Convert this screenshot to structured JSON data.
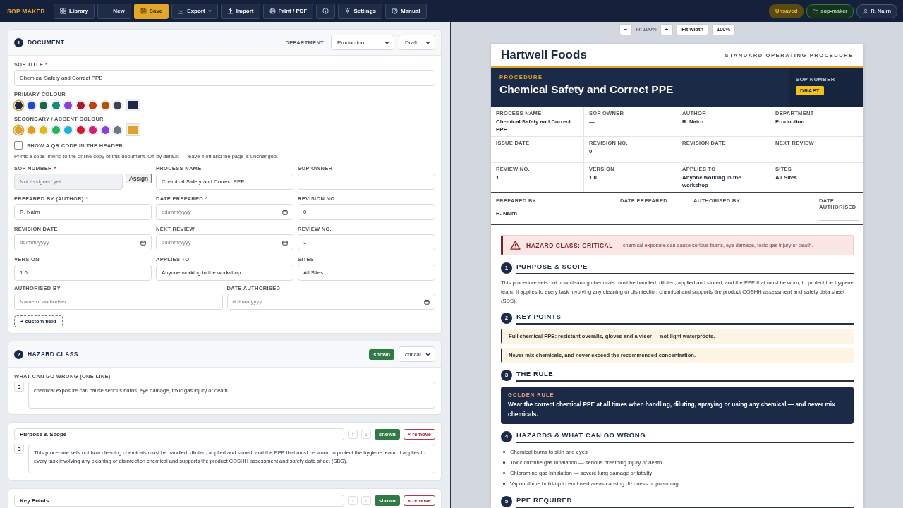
{
  "app": {
    "name": "SOP MAKER"
  },
  "toolbar": [
    {
      "label": "Library",
      "kind": "normal"
    },
    {
      "label": "New",
      "kind": "normal"
    },
    {
      "label": "Save",
      "kind": "primary"
    },
    {
      "label": "Export",
      "kind": "dropdown"
    },
    {
      "label": "Import",
      "kind": "normal"
    },
    {
      "label": "Print / PDF",
      "kind": "normal"
    },
    {
      "kind": "normal"
    },
    {
      "label": "Settings",
      "kind": "normal"
    },
    {
      "label": "Manual",
      "kind": "normal"
    }
  ],
  "status": [
    {
      "label": "Unsaved",
      "kind": "warning"
    },
    {
      "label": "sop-maker",
      "kind": "folder"
    },
    {
      "label": "R. Nairn",
      "kind": "user"
    }
  ],
  "zoom_bar": [
    {
      "label": "−",
      "kind": "button"
    },
    {
      "label": "Fit 100%",
      "kind": "text"
    },
    {
      "label": "+",
      "kind": "button"
    },
    {
      "label": "Fit width",
      "kind": "button"
    },
    {
      "label": "100%",
      "kind": "button"
    }
  ],
  "document_card": {
    "number": "1",
    "title": "DOCUMENT",
    "department_label": "DEPARTMENT",
    "department": "Production",
    "status": "Draft",
    "sop_title": {
      "label": "SOP TITLE",
      "required_mark": "*",
      "value": "Chemical Safety and Correct PPE"
    },
    "palettes": [
      {
        "label": "PRIMARY COLOUR",
        "swatches": [
          {
            "color": "#1b2a47",
            "selected": true
          },
          {
            "color": "#2346d4",
            "selected": false
          },
          {
            "color": "#176a45",
            "selected": false
          },
          {
            "color": "#1b8a72",
            "selected": false
          },
          {
            "color": "#8b3fe0",
            "selected": false
          },
          {
            "color": "#b0192a",
            "selected": false
          },
          {
            "color": "#c2410c",
            "selected": false
          },
          {
            "color": "#b45309",
            "selected": false
          },
          {
            "color": "#3b4252",
            "selected": false
          }
        ]
      },
      {
        "label": "SECONDARY / ACCENT COLOUR",
        "swatches": [
          {
            "color": "#e0a22a",
            "selected": true
          },
          {
            "color": "#ea9a14",
            "selected": false
          },
          {
            "color": "#e2b812",
            "selected": false
          },
          {
            "color": "#22b455",
            "selected": false
          },
          {
            "color": "#1fb0e0",
            "selected": false
          },
          {
            "color": "#d0192f",
            "selected": false
          },
          {
            "color": "#d81b7a",
            "selected": false
          },
          {
            "color": "#8b3fe0",
            "selected": false
          },
          {
            "color": "#6b7789",
            "selected": false
          }
        ]
      }
    ],
    "qr": {
      "label": "SHOW A QR CODE IN THE HEADER",
      "checked": false,
      "help": "Prints a code linking to the online copy of this document. Off by default — leave it off and the page is unchanged."
    },
    "field_rows": [
      [
        {
          "label": "SOP NUMBER",
          "required_mark": "*",
          "kind": "locked",
          "placeholder": "Not assigned yet",
          "button": "Assign"
        },
        {
          "label": "PROCESS NAME",
          "kind": "text",
          "value": "Chemical Safety and Correct PPE"
        },
        {
          "label": "SOP OWNER",
          "kind": "text"
        }
      ],
      [
        {
          "label": "PREPARED BY (AUTHOR)",
          "required_mark": "*",
          "kind": "text",
          "value": "R. Nairn"
        },
        {
          "label": "DATE PREPARED",
          "required_mark": "*",
          "kind": "date",
          "placeholder": "dd/mm/yyyy"
        },
        {
          "label": "REVISION NO.",
          "kind": "text",
          "value": "0"
        }
      ],
      [
        {
          "label": "REVISION DATE",
          "kind": "date",
          "placeholder": "dd/mm/yyyy"
        },
        {
          "label": "NEXT REVIEW",
          "kind": "date",
          "placeholder": "dd/mm/yyyy"
        },
        {
          "label": "REVIEW NO.",
          "kind": "text",
          "value": "1"
        }
      ],
      [
        {
          "label": "VERSION",
          "kind": "text",
          "value": "1.0"
        },
        {
          "label": "APPLIES TO",
          "kind": "text",
          "value": "Anyone working in the workshop"
        },
        {
          "label": "SITES",
          "kind": "text",
          "value": "All Sites"
        }
      ],
      [
        {
          "label": "AUTHORISED BY",
          "kind": "text",
          "placeholder": "Name of authoriser"
        },
        {
          "label": "DATE AUTHORISED",
          "kind": "date",
          "placeholder": "dd/mm/yyyy"
        }
      ]
    ],
    "custom_field_button": "+ custom field"
  },
  "hazard_card": {
    "number": "2",
    "title": "HAZARD CLASS",
    "visibility_label": "shown",
    "visible": true,
    "level": "critical",
    "field_label": "WHAT CAN GO WRONG (ONE LINE)",
    "bold_button": "B",
    "text": "chemical exposure can cause serious burns, eye damage, toxic gas injury or death."
  },
  "section_cards": [
    {
      "title": "Purpose & Scope",
      "up": "↑",
      "down": "↓",
      "visibility_label": "shown",
      "visible": true,
      "remove": "× remove",
      "bold_button": "B",
      "body": "This procedure sets out how cleaning chemicals must be handled, diluted, applied and stored, and the PPE that must be worn, to protect the hygiene team. It applies to every task involving any cleaning or disinfection chemical and supports the product COSHH assessment and safety data sheet (SDS)."
    },
    {
      "title": "Key Points",
      "up": "↑",
      "down": "↓",
      "visibility_label": "shown",
      "visible": true,
      "remove": "× remove"
    }
  ],
  "document": {
    "company": "Hartwell Foods",
    "doc_type": "STANDARD OPERATING PROCEDURE",
    "kicker": "PROCEDURE",
    "title": "Chemical Safety and Correct PPE",
    "sop_number_label": "SOP NUMBER",
    "status_badge": "DRAFT",
    "meta": [
      {
        "label": "PROCESS NAME",
        "value": "Chemical Safety and Correct PPE"
      },
      {
        "label": "SOP OWNER",
        "value": "—"
      },
      {
        "label": "AUTHOR",
        "value": "R. Nairn"
      },
      {
        "label": "DEPARTMENT",
        "value": "Production"
      },
      {
        "label": "ISSUE DATE",
        "value": "—"
      },
      {
        "label": "REVISION NO.",
        "value": "0"
      },
      {
        "label": "REVISION DATE",
        "value": "—"
      },
      {
        "label": "NEXT REVIEW",
        "value": "—"
      },
      {
        "label": "REVIEW NO.",
        "value": "1"
      },
      {
        "label": "VERSION",
        "value": "1.0"
      },
      {
        "label": "APPLIES TO",
        "value": "Anyone working in the workshop"
      },
      {
        "label": "SITES",
        "value": "All Sites"
      }
    ],
    "signatures": [
      {
        "label": "PREPARED BY",
        "value": "R. Nairn"
      },
      {
        "label": "DATE PREPARED"
      },
      {
        "label": "AUTHORISED BY"
      },
      {
        "label": "DATE AUTHORISED"
      }
    ],
    "hazard": {
      "label": "HAZARD CLASS: CRITICAL",
      "text": "chemical exposure can cause serious burns, eye damage, toxic gas injury or death."
    },
    "sections": [
      {
        "number": "1",
        "title": "PURPOSE & SCOPE",
        "kind": "paragraph",
        "text": "This procedure sets out how cleaning chemicals must be handled, diluted, applied and stored, and the PPE that must be worn, to protect the hygiene team. It applies to every task involving any cleaning or disinfection chemical and supports the product COSHH assessment and safety data sheet (SDS)."
      },
      {
        "number": "2",
        "title": "KEY POINTS",
        "kind": "callouts",
        "items": [
          "Full chemical PPE: resistant overalls, gloves and a visor — not light waterproofs.",
          "Never mix chemicals, and never exceed the recommended concentration."
        ]
      },
      {
        "number": "3",
        "title": "THE RULE",
        "kind": "rule",
        "label": "GOLDEN RULE",
        "text": "Wear the correct chemical PPE at all times when handling, diluting, spraying or using any chemical — and never mix chemicals."
      },
      {
        "number": "4",
        "title": "HAZARDS & WHAT CAN GO WRONG",
        "kind": "bullets",
        "items": [
          "Chemical burns to skin and eyes",
          "Toxic chlorine gas inhalation — serious breathing injury or death",
          "Chloramine gas inhalation — severe lung damage or fatality",
          "Vapour/fume build-up in enclosed areas causing dizziness or poisoning"
        ]
      },
      {
        "number": "5",
        "title": "PPE REQUIRED",
        "kind": "bullets"
      }
    ]
  }
}
